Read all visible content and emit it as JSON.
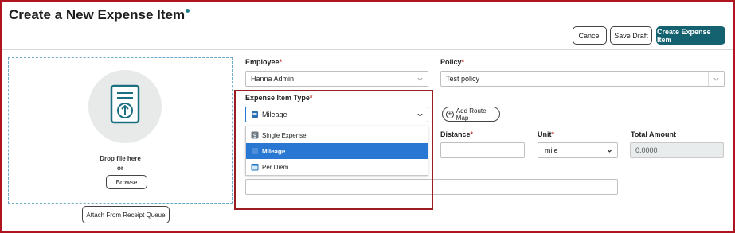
{
  "page": {
    "title": "Create a New Expense Item"
  },
  "toolbar": {
    "cancel_label": "Cancel",
    "save_draft_label": "Save Draft",
    "create_label": "Create Expense Item"
  },
  "upload": {
    "drop_text": "Drop file here",
    "or_text": "or",
    "browse_label": "Browse",
    "attach_label": "Attach From Receipt Queue"
  },
  "form": {
    "employee_label": "Employee",
    "employee_value": "Hanna Admin",
    "policy_label": "Policy",
    "policy_value": "Test policy",
    "expense_type_label": "Expense Item Type",
    "expense_type_value": "Mileage",
    "add_route_label": "Add Route Map",
    "distance_label": "Distance",
    "distance_value": "",
    "unit_label": "Unit",
    "unit_value": "mile",
    "total_label": "Total Amount",
    "total_value": "0.0000",
    "required_mark": "*"
  },
  "dropdown": {
    "options": [
      {
        "label": "Single Expense",
        "icon": "dollar-icon"
      },
      {
        "label": "Mileage",
        "icon": "car-icon"
      },
      {
        "label": "Per Diem",
        "icon": "calendar-icon"
      }
    ],
    "selected": "Mileage"
  },
  "colors": {
    "primary": "#14626f",
    "highlight_border": "#9a1d22",
    "selected_option": "#2878d3",
    "required": "#c0392b"
  }
}
